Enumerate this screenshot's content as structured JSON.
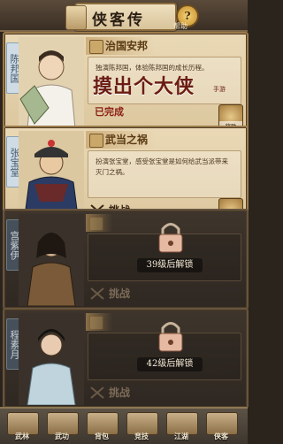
{
  "header": {
    "title": "侠客传",
    "help_label": "帮助",
    "help_glyph": "?"
  },
  "cards": [
    {
      "side_name": "陈邦国",
      "chapter": "治国安邦",
      "description": "独演陈邦国，体验陈邦国的成长历程。",
      "watermark": "摸出个大侠",
      "watermark_small": "手游",
      "stamp": "已完成",
      "badge_label": "奖励",
      "locked": false
    },
    {
      "side_name": "张宝堂",
      "chapter": "武当之祸",
      "description": "扮演张宝堂，感受张宝堂是如何给武当派带来灭门之祸。",
      "challenge": "挑战",
      "badge_label": "奖励",
      "locked": false
    },
    {
      "side_name": "宫紫伊",
      "chapter": "",
      "description": "",
      "challenge": "挑战",
      "lock_text": "39级后解锁",
      "locked": true
    },
    {
      "side_name": "程素月",
      "chapter": "",
      "description": "",
      "challenge": "挑战",
      "lock_text": "42级后解锁",
      "locked": true
    }
  ],
  "bottom_nav": [
    {
      "label": "武林",
      "icon": "wulin-icon"
    },
    {
      "label": "武功",
      "icon": "martial-icon"
    },
    {
      "label": "背包",
      "icon": "bag-icon"
    },
    {
      "label": "竞技",
      "icon": "swords-icon"
    },
    {
      "label": "江湖",
      "icon": "jianghu-icon"
    },
    {
      "label": "侠客",
      "icon": "hero-icon"
    }
  ]
}
